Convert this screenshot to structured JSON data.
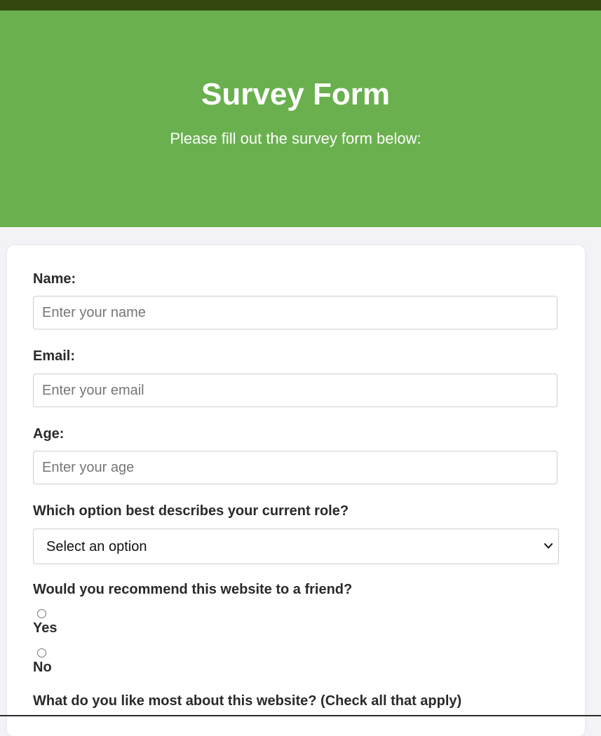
{
  "header": {
    "title": "Survey Form",
    "subtitle": "Please fill out the survey form below:"
  },
  "form": {
    "name": {
      "label": "Name:",
      "placeholder": "Enter your name",
      "value": ""
    },
    "email": {
      "label": "Email:",
      "placeholder": "Enter your email",
      "value": ""
    },
    "age": {
      "label": "Age:",
      "placeholder": "Enter your age",
      "value": ""
    },
    "role": {
      "label": "Which option best describes your current role?",
      "selected": "Select an option",
      "icon": "chevron-down-icon"
    },
    "recommend": {
      "label": "Would you recommend this website to a friend?",
      "options": [
        {
          "label": "Yes",
          "checked": false
        },
        {
          "label": "No",
          "checked": false
        }
      ]
    },
    "likes": {
      "label": "What do you like most about this website? (Check all that apply)"
    }
  },
  "colors": {
    "topbar": "#34470f",
    "hero": "#6ab04f",
    "page": "#f3f3f7",
    "card": "#ffffff"
  }
}
